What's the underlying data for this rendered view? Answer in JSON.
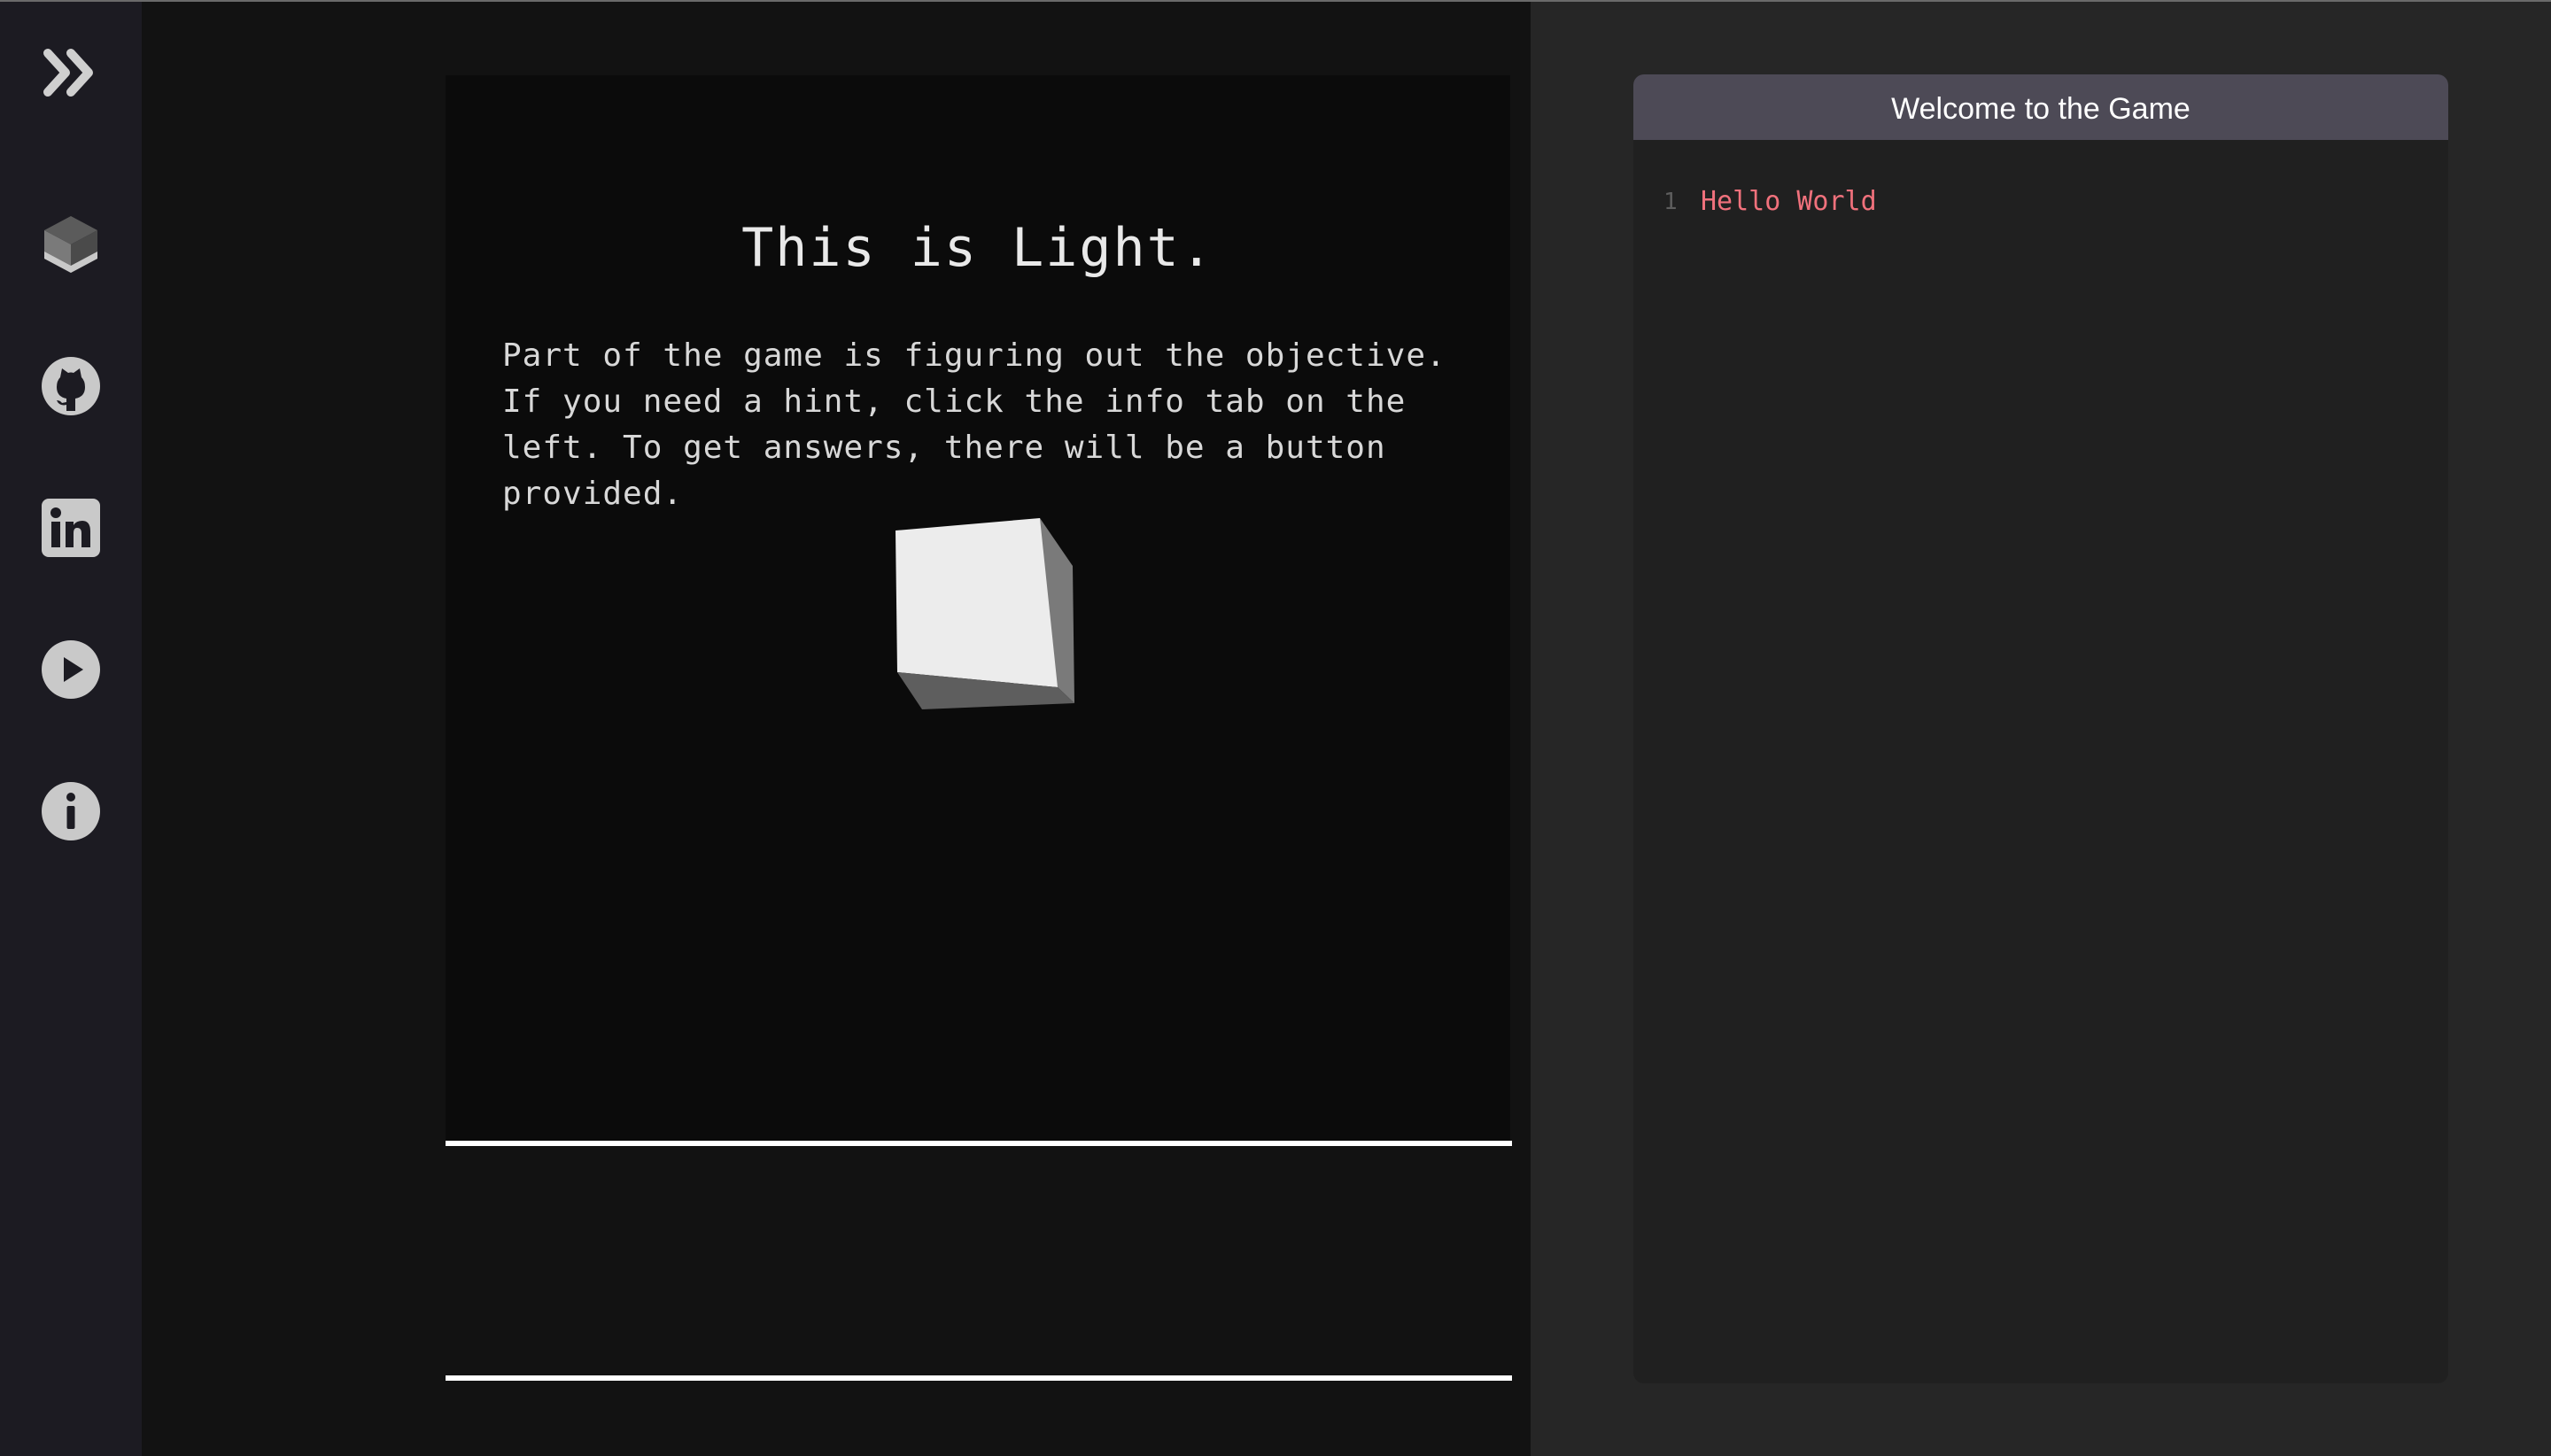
{
  "sidebar": {
    "items": [
      {
        "name": "expand-icon"
      },
      {
        "name": "cube-icon"
      },
      {
        "name": "github-icon"
      },
      {
        "name": "linkedin-icon"
      },
      {
        "name": "play-icon"
      },
      {
        "name": "info-icon"
      }
    ]
  },
  "game": {
    "title": "This is Light.",
    "description": "Part of the game is figuring out the objective.\nIf you need a hint, click the info tab on the\nleft. To get answers, there will be a button\nprovided."
  },
  "editor": {
    "title": "Welcome to the Game",
    "lines": [
      {
        "number": "1",
        "text": "Hello World"
      }
    ]
  },
  "colors": {
    "sidebar_bg": "#1c1b22",
    "game_bg": "#121212",
    "canvas_bg": "#0b0b0b",
    "panel_bg": "#262626",
    "editor_header": "#4d4a56",
    "code_text": "#f0717c",
    "icon_gray": "#c9c9c9"
  }
}
